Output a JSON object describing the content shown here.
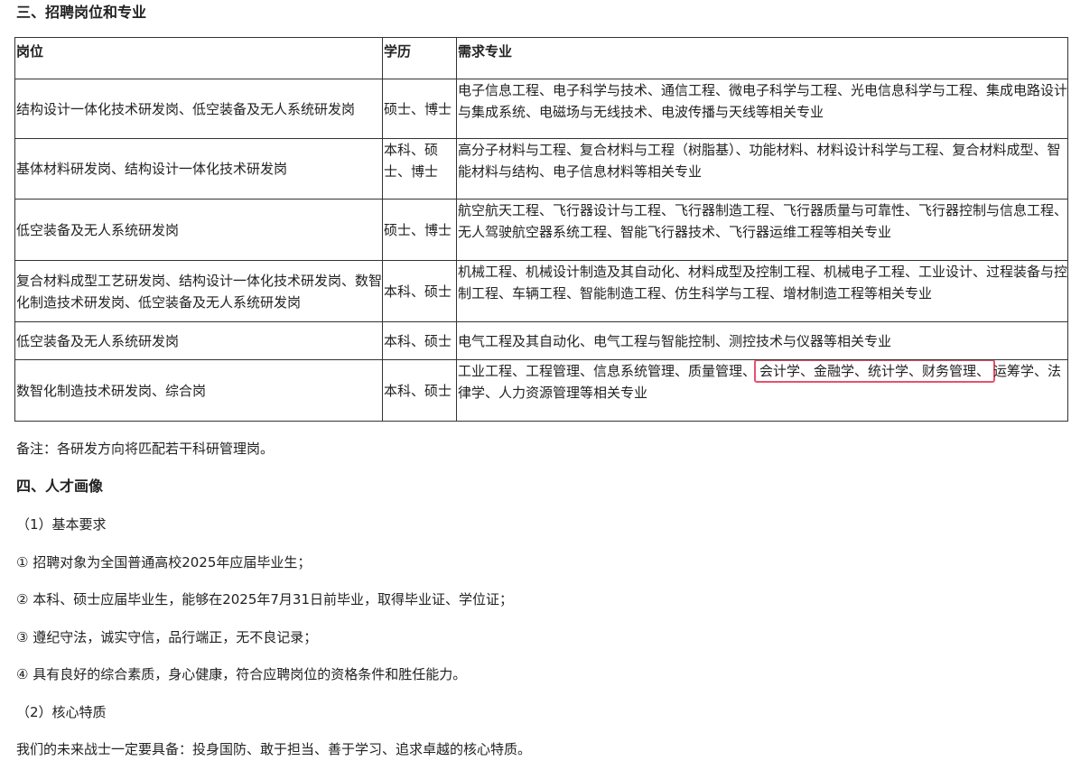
{
  "section3": {
    "title": "三、招聘岗位和专业"
  },
  "table": {
    "headers": [
      "岗位",
      "学历",
      "需求专业"
    ],
    "rows": [
      {
        "position": "结构设计一体化技术研发岗、低空装备及无人系统研发岗",
        "education": "硕士、博士",
        "majors": "电子信息工程、电子科学与技术、通信工程、微电子科学与工程、光电信息科学与工程、集成电路设计与集成系统、电磁场与无线技术、电波传播与天线等相关专业"
      },
      {
        "position": "基体材料研发岗、结构设计一体化技术研发岗",
        "education": "本科、硕士、博士",
        "majors": "高分子材料与工程、复合材料与工程（树脂基）、功能材料、材料设计科学与工程、复合材料成型、智能材料与结构、电子信息材料等相关专业"
      },
      {
        "position": "低空装备及无人系统研发岗",
        "education": "硕士、博士",
        "majors": "航空航天工程、飞行器设计与工程、飞行器制造工程、飞行器质量与可靠性、飞行器控制与信息工程、无人驾驶航空器系统工程、智能飞行器技术、飞行器运维工程等相关专业"
      },
      {
        "position": "复合材料成型工艺研发岗、结构设计一体化技术研发岗、数智化制造技术研发岗、低空装备及无人系统研发岗",
        "education": "本科、硕士",
        "majors": "机械工程、机械设计制造及其自动化、材料成型及控制工程、机械电子工程、工业设计、过程装备与控制工程、车辆工程、智能制造工程、仿生科学与工程、增材制造工程等相关专业"
      },
      {
        "position": "低空装备及无人系统研发岗",
        "education": "本科、硕士",
        "majors": "电气工程及其自动化、电气工程与智能控制、测控技术与仪器等相关专业"
      },
      {
        "position": "数智化制造技术研发岗、综合岗",
        "education": "本科、硕士",
        "majors_before": "工业工程、工程管理、信息系统管理、质量管理、",
        "majors_highlight": "会计学、金融学、统计学、财务管理、",
        "majors_after": "运筹学、法律学、人力资源管理等相关专业"
      }
    ]
  },
  "note": "备注：各研发方向将匹配若干科研管理岗。",
  "section4": {
    "title": "四、人才画像"
  },
  "basic": {
    "title": "（1）基本要求",
    "items": [
      "① 招聘对象为全国普通高校2025年应届毕业生；",
      "② 本科、硕士应届毕业生，能够在2025年7月31日前毕业，取得毕业证、学位证；",
      "③ 遵纪守法，诚实守信，品行端正，无不良记录；",
      "④ 具有良好的综合素质，身心健康，符合应聘岗位的资格条件和胜任能力。"
    ]
  },
  "core": {
    "title": "（2）核心特质",
    "text": "我们的未来战士一定要具备：投身国防、敢于担当、善于学习、追求卓越的核心特质。"
  },
  "colors": {
    "highlight_border": "#e8506d"
  }
}
